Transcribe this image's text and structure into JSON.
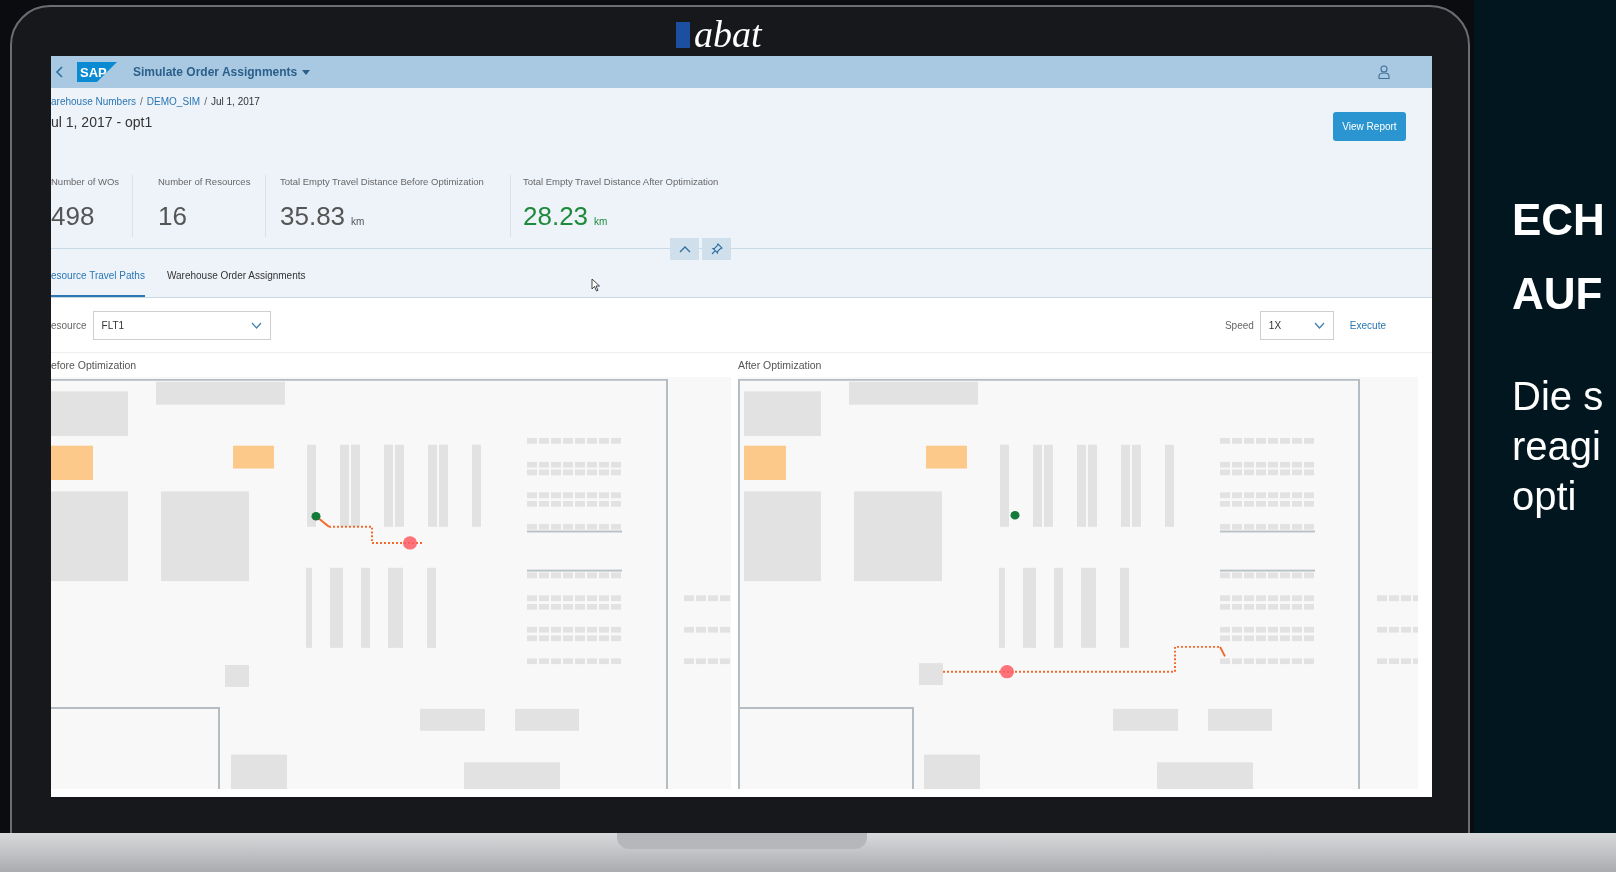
{
  "logo": "abat",
  "shell_bar": {
    "logo": "SAP",
    "title": "Simulate Order Assignments"
  },
  "breadcrumbs": [
    {
      "label": "arehouse Numbers",
      "kind": "link"
    },
    {
      "label": "/",
      "kind": "separator"
    },
    {
      "label": "DEMO_SIM",
      "kind": "link"
    },
    {
      "label": "/",
      "kind": "separator"
    },
    {
      "label": "Jul 1, 2017",
      "kind": "current"
    }
  ],
  "page_title": "ul 1, 2017 - opt1",
  "header_button": "View Report",
  "kpis": [
    {
      "label": "Number of WOs",
      "value": "498",
      "positive": false
    },
    {
      "label": "Number of Resources",
      "value": "16",
      "positive": false
    },
    {
      "label": "Total Empty Travel Distance Before Optimization",
      "value": "35.83",
      "unit": "km",
      "positive": false
    },
    {
      "label": "Total Empty Travel Distance After Optimization",
      "value": "28.23",
      "unit": "km",
      "positive": true
    }
  ],
  "tabs": [
    {
      "label": "esource Travel Paths",
      "selected": true
    },
    {
      "label": "Warehouse Order Assignments",
      "selected": false
    }
  ],
  "resource_filter": {
    "label": "esource",
    "value": "FLT1"
  },
  "speed": {
    "label": "Speed",
    "value": "1X"
  },
  "execute": "Execute",
  "maps": [
    {
      "title": "efore Optimization"
    },
    {
      "title": "After Optimization"
    }
  ],
  "side_text": {
    "heading": [
      "ECH",
      "AUF"
    ],
    "body": [
      "Die s",
      "reagi",
      "opti"
    ]
  }
}
